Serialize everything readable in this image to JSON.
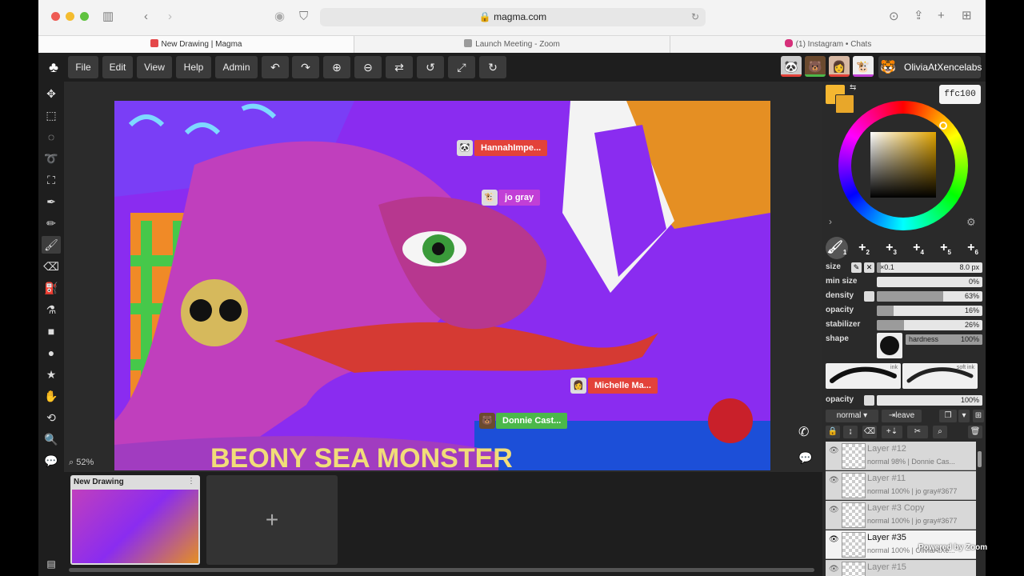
{
  "browser": {
    "url": "magma.com",
    "tabs": [
      {
        "label": "New Drawing | Magma",
        "active": true
      },
      {
        "label": "Launch Meeting - Zoom",
        "active": false
      },
      {
        "label": "(1) Instagram • Chats",
        "active": false
      }
    ]
  },
  "menu": {
    "file": "File",
    "edit": "Edit",
    "view": "View",
    "help": "Help",
    "admin": "Admin"
  },
  "users": {
    "current": "OliviaAtXencelabs"
  },
  "cursors": [
    {
      "name": "HannahImpe...",
      "color": "#e3423a"
    },
    {
      "name": "jo gray",
      "color": "#c13fd6"
    },
    {
      "name": "Michelle Ma...",
      "color": "#e3423a"
    },
    {
      "name": "Donnie Cast...",
      "color": "#4bb84a"
    }
  ],
  "art": {
    "text": "BEONY SEA MONSTER"
  },
  "canvas": {
    "zoom": "52%"
  },
  "thumbnails": [
    {
      "title": "New Drawing"
    }
  ],
  "color": {
    "hex": "ffc100",
    "primary": "#f5b731",
    "secondary": "#e8a72a"
  },
  "brushes": [
    "1",
    "2",
    "3",
    "4",
    "5",
    "6"
  ],
  "brush": {
    "size": {
      "label": "size",
      "scale": "×0.1",
      "value": "8.0 px",
      "fill": 0.04
    },
    "min_size": {
      "label": "min size",
      "value": "0%",
      "fill": 0
    },
    "density": {
      "label": "density",
      "value": "63%",
      "fill": 0.63
    },
    "opacity": {
      "label": "opacity",
      "value": "16%",
      "fill": 0.16
    },
    "stabilizer": {
      "label": "stabilizer",
      "value": "26%",
      "fill": 0.26
    },
    "shape": {
      "label": "shape"
    },
    "hardness": {
      "label": "hardness",
      "value": "100%",
      "fill": 1
    },
    "presets": [
      "ink",
      "soft ink"
    ]
  },
  "layer_controls": {
    "opacity_label": "opacity",
    "opacity_value": "100%",
    "blend": "normal",
    "leave": "leave"
  },
  "layers": [
    {
      "name": "Layer #12",
      "detail": "normal 98% | Donnie Cas...",
      "active": false
    },
    {
      "name": "Layer #11",
      "detail": "normal 100% | jo gray#3677",
      "active": false
    },
    {
      "name": "Layer #3 Copy",
      "detail": "normal 100% | jo gray#3677",
      "active": false
    },
    {
      "name": "Layer #35",
      "detail": "normal 100% | OliviaAtXe...",
      "active": true
    },
    {
      "name": "Layer #15",
      "detail": "",
      "active": false
    }
  ],
  "overlay": {
    "zoom_powered": "Powered by Zoom"
  }
}
